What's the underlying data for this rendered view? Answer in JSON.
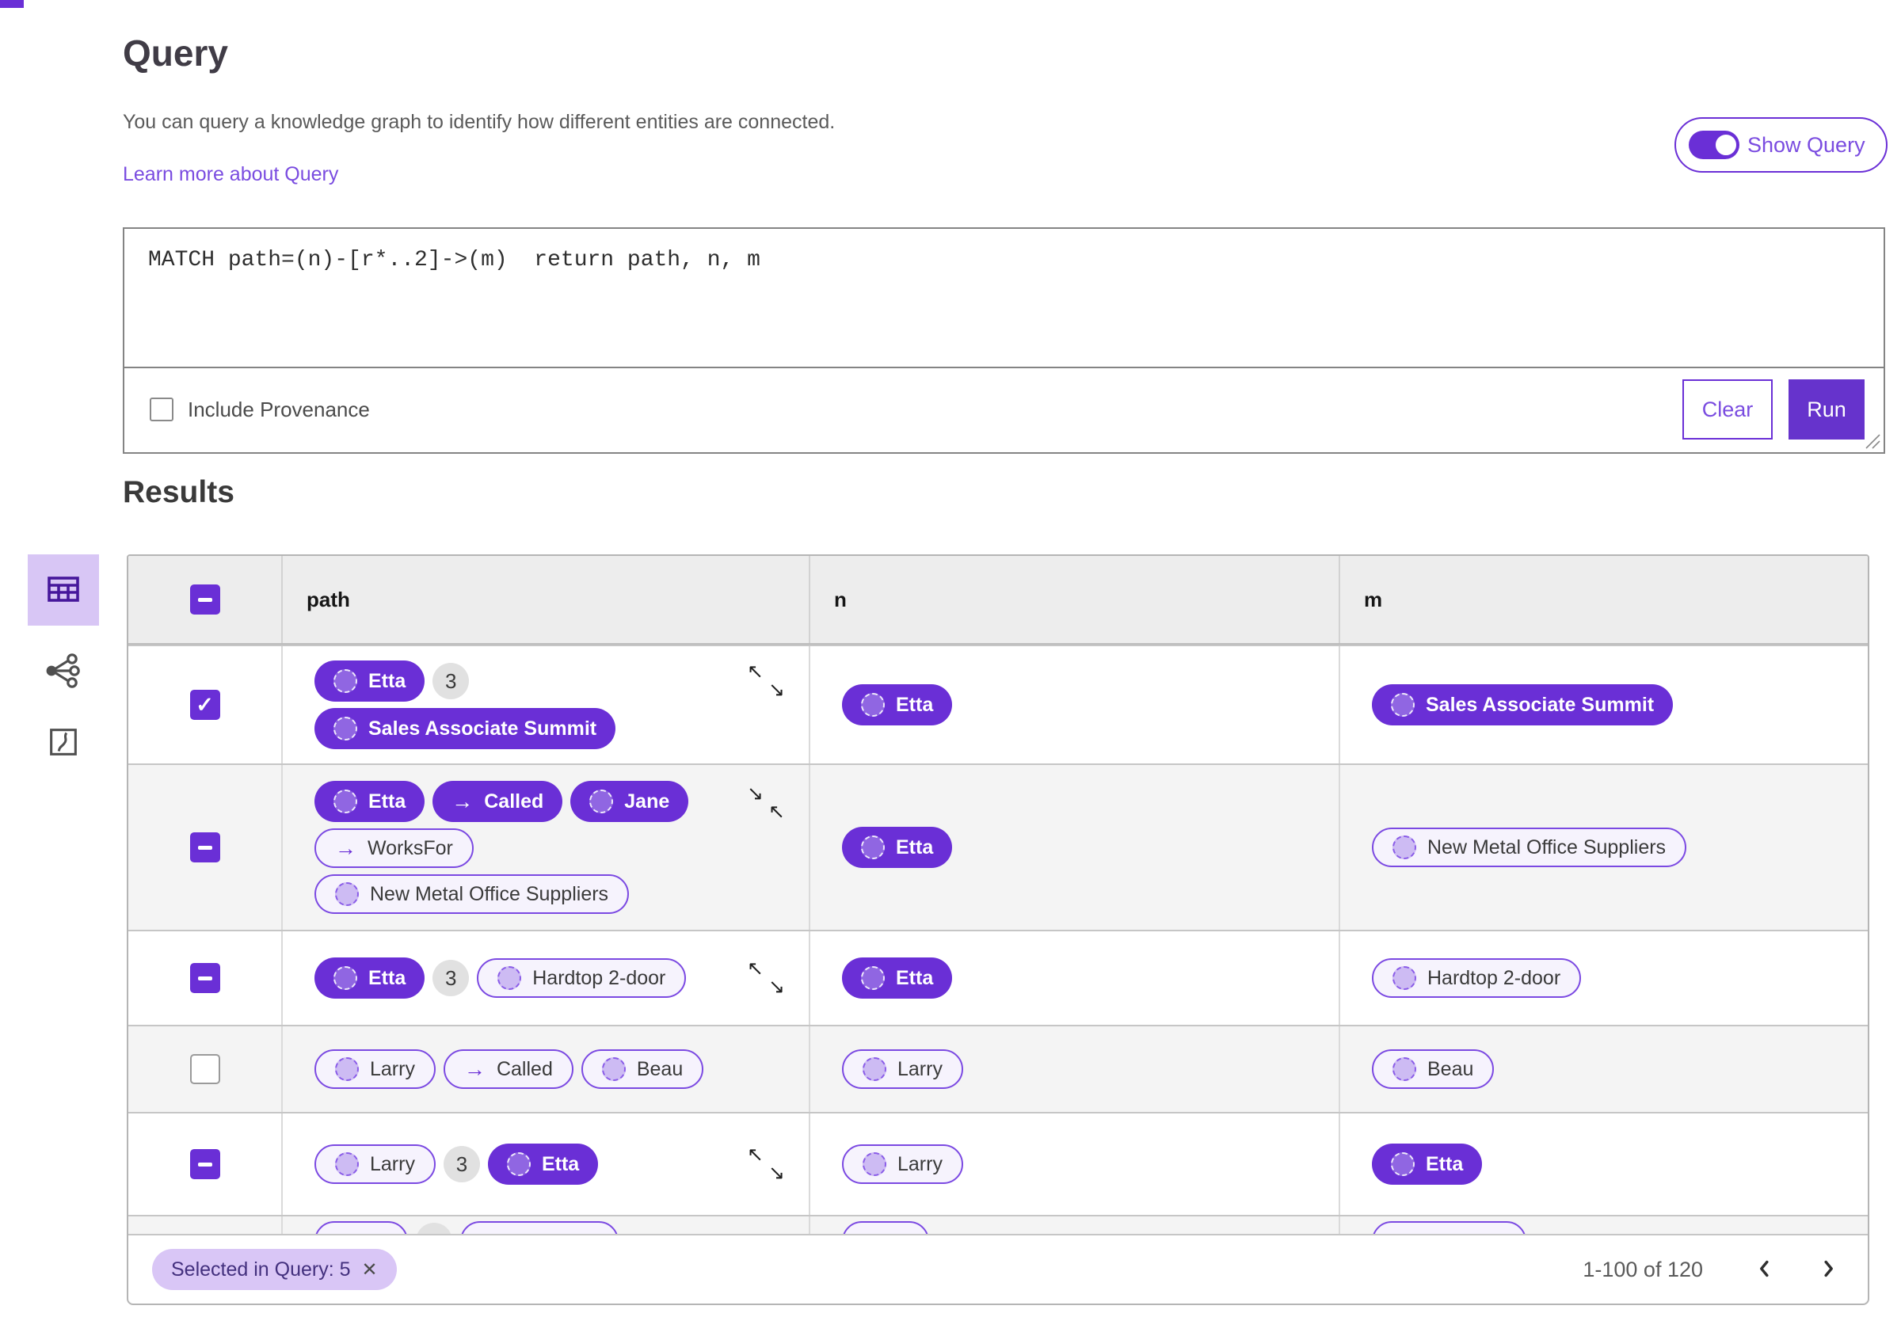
{
  "colors": {
    "accent": "#6a2fd6",
    "accent_light": "#d9c6f6",
    "run_button": "#6633cc",
    "outline_pill_border": "#7b49e2",
    "outline_pill_bg": "#f6f3fd",
    "link": "#7a4ce0",
    "row_alt_bg": "#f4f4f4"
  },
  "glyphs": {
    "arrow_right": "→",
    "expand_tl": "↖",
    "expand_br": "↘",
    "collapse_tl": "↘",
    "collapse_br": "↖",
    "check": "✓",
    "close": "✕"
  },
  "header": {
    "title": "Query",
    "subtitle": "You can query a knowledge graph to identify how different entities are connected.",
    "learn_more": "Learn more about Query",
    "show_query_label": "Show Query",
    "show_query_state": "on"
  },
  "query_editor": {
    "code": "MATCH path=(n)-[r*..2]->(m)  return path, n, m",
    "include_provenance_label": "Include Provenance",
    "include_provenance_checked": false,
    "clear_label": "Clear",
    "run_label": "Run"
  },
  "results": {
    "title": "Results",
    "view_modes": [
      "table",
      "graph",
      "chart"
    ],
    "active_view": "table",
    "columns": {
      "path": "path",
      "n": "n",
      "m": "m"
    },
    "header_checkbox": "indeterminate",
    "rows": [
      {
        "select": "checked",
        "expand": "expand",
        "path": [
          [
            {
              "type": "node-filled",
              "label": "Etta"
            },
            {
              "type": "badge",
              "label": "3"
            }
          ],
          [
            {
              "type": "node-filled",
              "label": "Sales Associate Summit"
            }
          ]
        ],
        "n": {
          "type": "node-filled",
          "label": "Etta"
        },
        "m": {
          "type": "node-filled",
          "label": "Sales Associate Summit"
        }
      },
      {
        "select": "indeterminate",
        "expand": "collapse",
        "path": [
          [
            {
              "type": "node-filled",
              "label": "Etta"
            },
            {
              "type": "edge-filled",
              "label": "Called"
            },
            {
              "type": "node-filled",
              "label": "Jane"
            }
          ],
          [
            {
              "type": "edge-outline",
              "label": "WorksFor"
            }
          ],
          [
            {
              "type": "node-outline",
              "label": "New Metal Office Suppliers"
            }
          ]
        ],
        "n": {
          "type": "node-filled",
          "label": "Etta"
        },
        "m": {
          "type": "node-outline",
          "label": "New Metal Office Suppliers"
        }
      },
      {
        "select": "indeterminate",
        "expand": "expand",
        "path": [
          [
            {
              "type": "node-filled",
              "label": "Etta"
            },
            {
              "type": "badge",
              "label": "3"
            },
            {
              "type": "node-outline",
              "label": "Hardtop 2-door"
            }
          ]
        ],
        "n": {
          "type": "node-filled",
          "label": "Etta"
        },
        "m": {
          "type": "node-outline",
          "label": "Hardtop 2-door"
        }
      },
      {
        "select": "unchecked",
        "expand": "none",
        "path": [
          [
            {
              "type": "node-outline",
              "label": "Larry"
            },
            {
              "type": "edge-outline",
              "label": "Called"
            },
            {
              "type": "node-outline",
              "label": "Beau"
            }
          ]
        ],
        "n": {
          "type": "node-outline",
          "label": "Larry"
        },
        "m": {
          "type": "node-outline",
          "label": "Beau"
        }
      },
      {
        "select": "indeterminate",
        "expand": "expand",
        "path": [
          [
            {
              "type": "node-outline",
              "label": "Larry"
            },
            {
              "type": "badge",
              "label": "3"
            },
            {
              "type": "node-filled",
              "label": "Etta"
            }
          ]
        ],
        "n": {
          "type": "node-outline",
          "label": "Larry"
        },
        "m": {
          "type": "node-filled",
          "label": "Etta"
        }
      }
    ],
    "footer": {
      "selected_chip": "Selected in Query: 5",
      "range": "1-100 of 120"
    }
  }
}
